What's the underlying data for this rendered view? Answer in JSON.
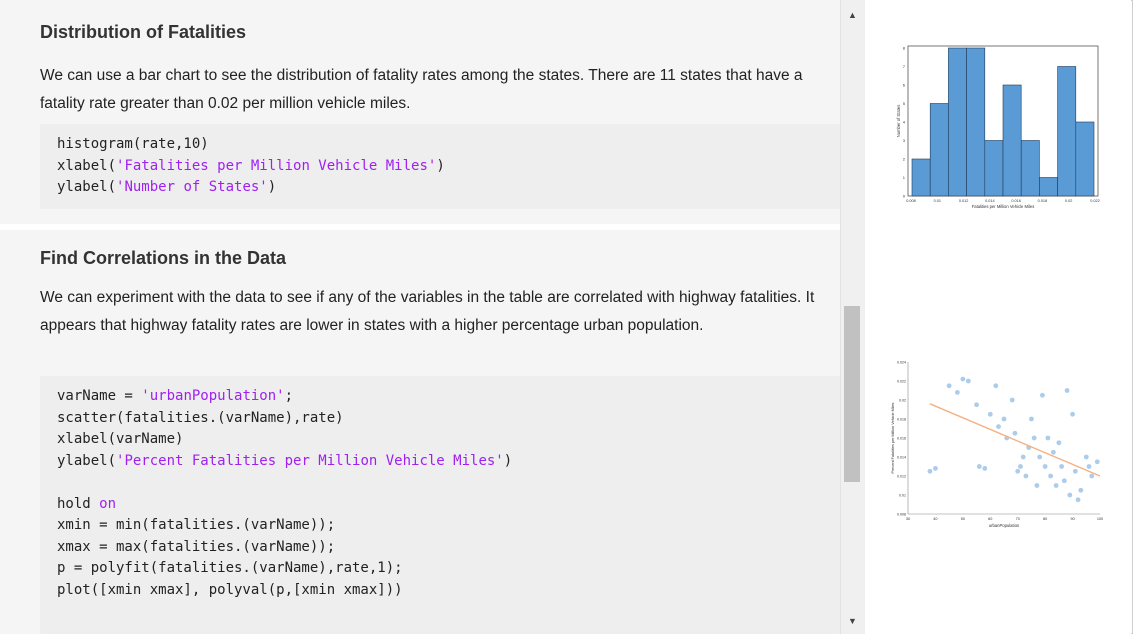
{
  "section1": {
    "title": "Distribution of Fatalities",
    "paragraph": "We can use a bar chart to see the distribution of fatality rates among the states. There are 11 states that have a fatality rate greater than 0.02 per million vehicle miles.",
    "code": {
      "line1": "histogram(rate,10)",
      "line2_fn": "xlabel(",
      "line2_str": "'Fatalities per Million Vehicle Miles'",
      "line2_end": ")",
      "line3_fn": "ylabel(",
      "line3_str": "'Number of States'",
      "line3_end": ")"
    }
  },
  "section2": {
    "title": "Find Correlations in the Data",
    "paragraph": "We can experiment with the data to see if any of the variables in the table are correlated with highway fatalities. It appears that highway fatality rates are lower in states with a higher percentage urban population.",
    "code": {
      "l1_pre": "varName = ",
      "l1_str": "'urbanPopulation'",
      "l1_end": ";",
      "l2": "scatter(fatalities.(varName),rate)",
      "l3": "xlabel(varName)",
      "l4_fn": "ylabel(",
      "l4_str": "'Percent Fatalities per Million Vehicle Miles'",
      "l4_end": ")",
      "l6_pre": "hold ",
      "l6_kw": "on",
      "l7": "xmin = min(fatalities.(varName));",
      "l8": "xmax = max(fatalities.(varName));",
      "l9": "p = polyfit(fatalities.(varName),rate,1);",
      "l10": "plot([xmin xmax], polyval(p,[xmin xmax]))"
    }
  },
  "chart_data": [
    {
      "type": "bar",
      "xlabel": "Fatalities per Million Vehicle Miles",
      "ylabel": "Number of States",
      "categories": [
        "0.008-0.009",
        "0.009-0.010",
        "0.010-0.011",
        "0.011-0.012",
        "0.012-0.013",
        "0.013-0.014",
        "0.014-0.015",
        "0.015-0.016",
        "0.016-0.017",
        "0.017-0.018"
      ],
      "values": [
        2,
        5,
        8,
        8,
        3,
        6,
        3,
        1,
        7,
        4
      ],
      "xticks": [
        "0.008",
        "0.01",
        "0.012",
        "0.014",
        "0.016",
        "0.018",
        "0.02",
        "0.022"
      ],
      "ylim": [
        0,
        8
      ],
      "color": "#5b9bd5"
    },
    {
      "type": "scatter",
      "xlabel": "urbanPopulation",
      "ylabel": "Percent Fatalities per Million Vehicle Miles",
      "xlim": [
        30,
        100
      ],
      "ylim": [
        0.008,
        0.024
      ],
      "xticks": [
        "30",
        "40",
        "50",
        "60",
        "70",
        "80",
        "90",
        "100"
      ],
      "yticks": [
        "0.024",
        "0.022",
        "0.02",
        "0.018",
        "0.016",
        "0.014",
        "0.012",
        "0.01",
        "0.008"
      ],
      "points": [
        [
          38,
          0.0125
        ],
        [
          40,
          0.0128
        ],
        [
          45,
          0.0215
        ],
        [
          48,
          0.0208
        ],
        [
          50,
          0.0222
        ],
        [
          52,
          0.022
        ],
        [
          55,
          0.0195
        ],
        [
          56,
          0.013
        ],
        [
          58,
          0.0128
        ],
        [
          60,
          0.0185
        ],
        [
          62,
          0.0215
        ],
        [
          63,
          0.0172
        ],
        [
          65,
          0.018
        ],
        [
          66,
          0.016
        ],
        [
          68,
          0.02
        ],
        [
          69,
          0.0165
        ],
        [
          70,
          0.0125
        ],
        [
          71,
          0.013
        ],
        [
          72,
          0.014
        ],
        [
          73,
          0.012
        ],
        [
          74,
          0.015
        ],
        [
          75,
          0.018
        ],
        [
          76,
          0.016
        ],
        [
          77,
          0.011
        ],
        [
          78,
          0.014
        ],
        [
          79,
          0.0205
        ],
        [
          80,
          0.013
        ],
        [
          81,
          0.016
        ],
        [
          82,
          0.012
        ],
        [
          83,
          0.0145
        ],
        [
          84,
          0.011
        ],
        [
          85,
          0.0155
        ],
        [
          86,
          0.013
        ],
        [
          87,
          0.0115
        ],
        [
          88,
          0.021
        ],
        [
          89,
          0.01
        ],
        [
          90,
          0.0185
        ],
        [
          91,
          0.0125
        ],
        [
          92,
          0.0095
        ],
        [
          93,
          0.0105
        ],
        [
          95,
          0.014
        ],
        [
          96,
          0.013
        ],
        [
          97,
          0.012
        ],
        [
          99,
          0.0135
        ]
      ],
      "fit_line": [
        [
          38,
          0.0196
        ],
        [
          100,
          0.012
        ]
      ],
      "point_color": "#9cc3e6",
      "line_color": "#f4b183"
    }
  ],
  "colors": {
    "panel_bg": "#f5f5f5",
    "code_bg": "#eeeeee",
    "string": "#a020f0"
  }
}
